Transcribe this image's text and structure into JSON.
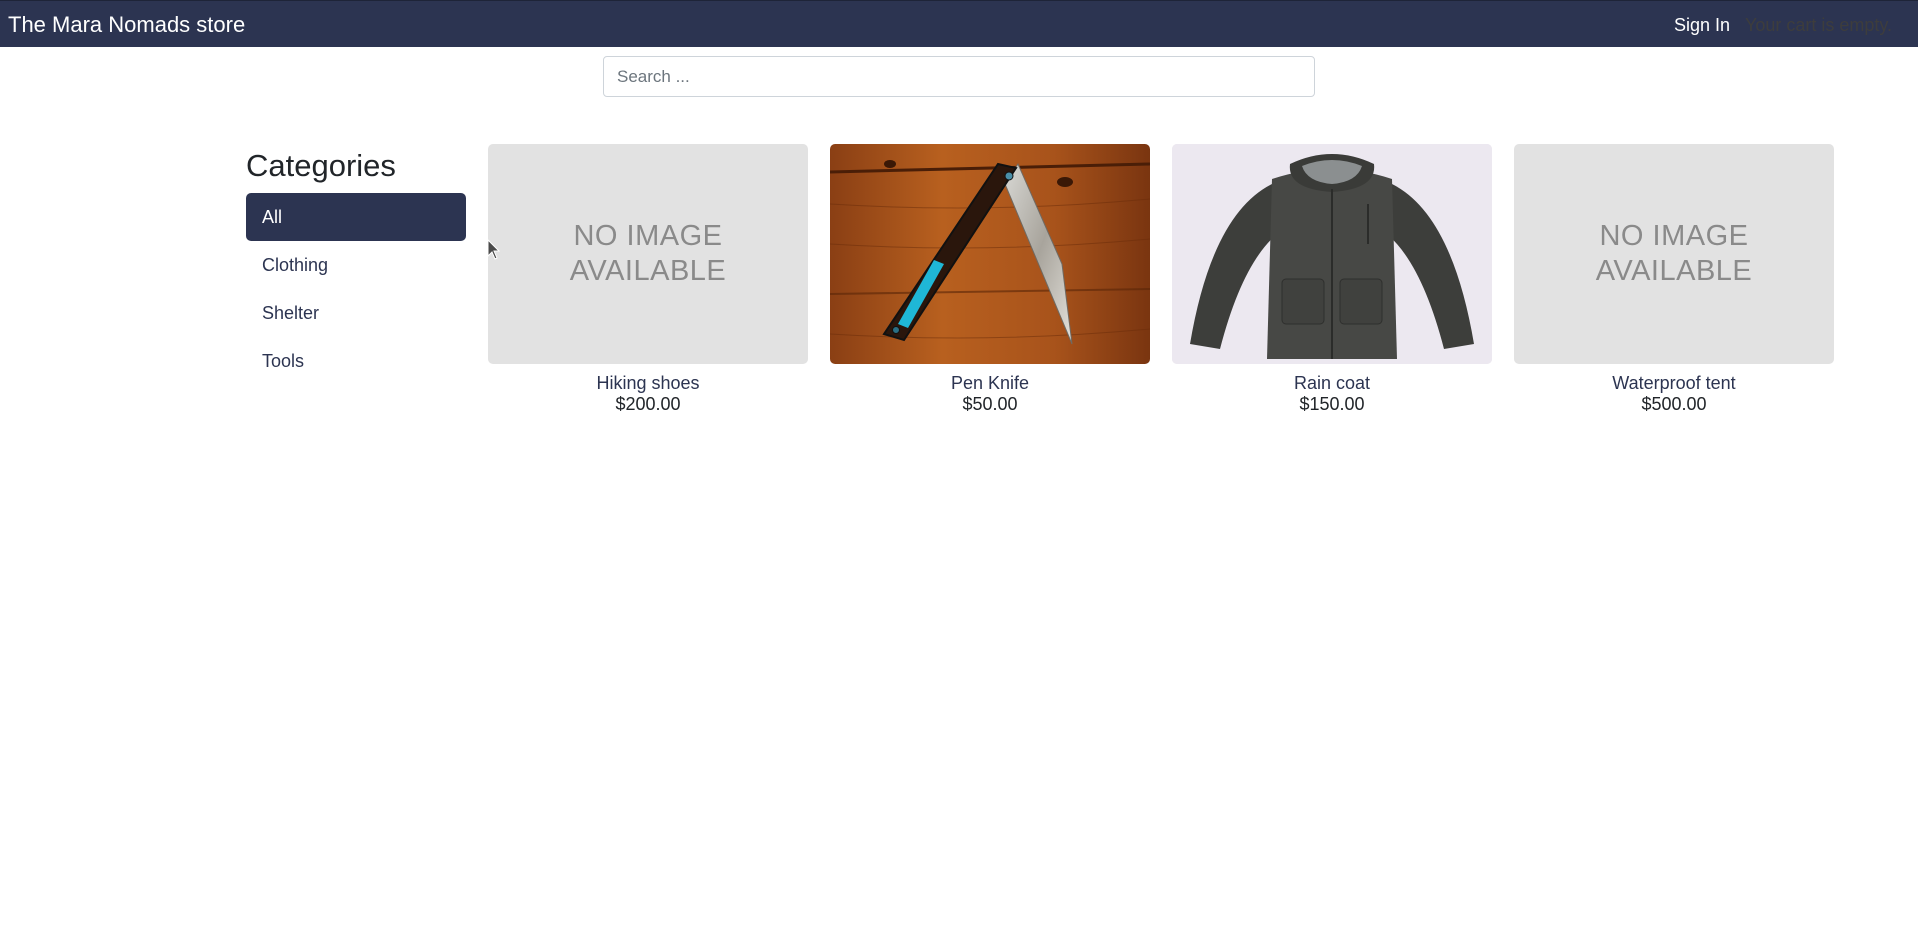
{
  "navbar": {
    "brand": "The Mara Nomads store",
    "sign_in": "Sign In",
    "cart_status": "Your cart is empty."
  },
  "search": {
    "placeholder": "Search ...",
    "value": ""
  },
  "categories": {
    "title": "Categories",
    "items": [
      {
        "label": "All",
        "active": true
      },
      {
        "label": "Clothing",
        "active": false
      },
      {
        "label": "Shelter",
        "active": false
      },
      {
        "label": "Tools",
        "active": false
      }
    ]
  },
  "products": [
    {
      "name": "Hiking shoes",
      "price": "$200.00",
      "image": "no-image-placeholder",
      "placeholder_text": "NO IMAGE AVAILABLE"
    },
    {
      "name": "Pen Knife",
      "price": "$50.00",
      "image": "pen-knife-photo"
    },
    {
      "name": "Rain coat",
      "price": "$150.00",
      "image": "rain-coat-photo"
    },
    {
      "name": "Waterproof tent",
      "price": "$500.00",
      "image": "no-image-placeholder",
      "placeholder_text": "NO IMAGE AVAILABLE"
    }
  ],
  "colors": {
    "navbar_bg": "#2c3451",
    "active_category_bg": "#2c3451",
    "placeholder_bg": "#e2e2e2"
  }
}
